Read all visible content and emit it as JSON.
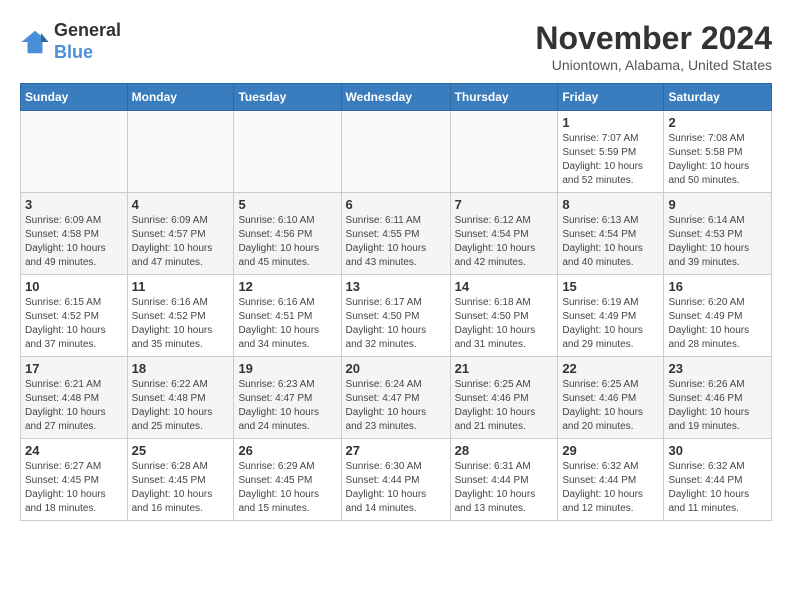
{
  "header": {
    "logo_line1": "General",
    "logo_line2": "Blue",
    "title": "November 2024",
    "subtitle": "Uniontown, Alabama, United States"
  },
  "days_of_week": [
    "Sunday",
    "Monday",
    "Tuesday",
    "Wednesday",
    "Thursday",
    "Friday",
    "Saturday"
  ],
  "weeks": [
    [
      {
        "day": "",
        "info": ""
      },
      {
        "day": "",
        "info": ""
      },
      {
        "day": "",
        "info": ""
      },
      {
        "day": "",
        "info": ""
      },
      {
        "day": "",
        "info": ""
      },
      {
        "day": "1",
        "info": "Sunrise: 7:07 AM\nSunset: 5:59 PM\nDaylight: 10 hours and 52 minutes."
      },
      {
        "day": "2",
        "info": "Sunrise: 7:08 AM\nSunset: 5:58 PM\nDaylight: 10 hours and 50 minutes."
      }
    ],
    [
      {
        "day": "3",
        "info": "Sunrise: 6:09 AM\nSunset: 4:58 PM\nDaylight: 10 hours and 49 minutes."
      },
      {
        "day": "4",
        "info": "Sunrise: 6:09 AM\nSunset: 4:57 PM\nDaylight: 10 hours and 47 minutes."
      },
      {
        "day": "5",
        "info": "Sunrise: 6:10 AM\nSunset: 4:56 PM\nDaylight: 10 hours and 45 minutes."
      },
      {
        "day": "6",
        "info": "Sunrise: 6:11 AM\nSunset: 4:55 PM\nDaylight: 10 hours and 43 minutes."
      },
      {
        "day": "7",
        "info": "Sunrise: 6:12 AM\nSunset: 4:54 PM\nDaylight: 10 hours and 42 minutes."
      },
      {
        "day": "8",
        "info": "Sunrise: 6:13 AM\nSunset: 4:54 PM\nDaylight: 10 hours and 40 minutes."
      },
      {
        "day": "9",
        "info": "Sunrise: 6:14 AM\nSunset: 4:53 PM\nDaylight: 10 hours and 39 minutes."
      }
    ],
    [
      {
        "day": "10",
        "info": "Sunrise: 6:15 AM\nSunset: 4:52 PM\nDaylight: 10 hours and 37 minutes."
      },
      {
        "day": "11",
        "info": "Sunrise: 6:16 AM\nSunset: 4:52 PM\nDaylight: 10 hours and 35 minutes."
      },
      {
        "day": "12",
        "info": "Sunrise: 6:16 AM\nSunset: 4:51 PM\nDaylight: 10 hours and 34 minutes."
      },
      {
        "day": "13",
        "info": "Sunrise: 6:17 AM\nSunset: 4:50 PM\nDaylight: 10 hours and 32 minutes."
      },
      {
        "day": "14",
        "info": "Sunrise: 6:18 AM\nSunset: 4:50 PM\nDaylight: 10 hours and 31 minutes."
      },
      {
        "day": "15",
        "info": "Sunrise: 6:19 AM\nSunset: 4:49 PM\nDaylight: 10 hours and 29 minutes."
      },
      {
        "day": "16",
        "info": "Sunrise: 6:20 AM\nSunset: 4:49 PM\nDaylight: 10 hours and 28 minutes."
      }
    ],
    [
      {
        "day": "17",
        "info": "Sunrise: 6:21 AM\nSunset: 4:48 PM\nDaylight: 10 hours and 27 minutes."
      },
      {
        "day": "18",
        "info": "Sunrise: 6:22 AM\nSunset: 4:48 PM\nDaylight: 10 hours and 25 minutes."
      },
      {
        "day": "19",
        "info": "Sunrise: 6:23 AM\nSunset: 4:47 PM\nDaylight: 10 hours and 24 minutes."
      },
      {
        "day": "20",
        "info": "Sunrise: 6:24 AM\nSunset: 4:47 PM\nDaylight: 10 hours and 23 minutes."
      },
      {
        "day": "21",
        "info": "Sunrise: 6:25 AM\nSunset: 4:46 PM\nDaylight: 10 hours and 21 minutes."
      },
      {
        "day": "22",
        "info": "Sunrise: 6:25 AM\nSunset: 4:46 PM\nDaylight: 10 hours and 20 minutes."
      },
      {
        "day": "23",
        "info": "Sunrise: 6:26 AM\nSunset: 4:46 PM\nDaylight: 10 hours and 19 minutes."
      }
    ],
    [
      {
        "day": "24",
        "info": "Sunrise: 6:27 AM\nSunset: 4:45 PM\nDaylight: 10 hours and 18 minutes."
      },
      {
        "day": "25",
        "info": "Sunrise: 6:28 AM\nSunset: 4:45 PM\nDaylight: 10 hours and 16 minutes."
      },
      {
        "day": "26",
        "info": "Sunrise: 6:29 AM\nSunset: 4:45 PM\nDaylight: 10 hours and 15 minutes."
      },
      {
        "day": "27",
        "info": "Sunrise: 6:30 AM\nSunset: 4:44 PM\nDaylight: 10 hours and 14 minutes."
      },
      {
        "day": "28",
        "info": "Sunrise: 6:31 AM\nSunset: 4:44 PM\nDaylight: 10 hours and 13 minutes."
      },
      {
        "day": "29",
        "info": "Sunrise: 6:32 AM\nSunset: 4:44 PM\nDaylight: 10 hours and 12 minutes."
      },
      {
        "day": "30",
        "info": "Sunrise: 6:32 AM\nSunset: 4:44 PM\nDaylight: 10 hours and 11 minutes."
      }
    ]
  ]
}
